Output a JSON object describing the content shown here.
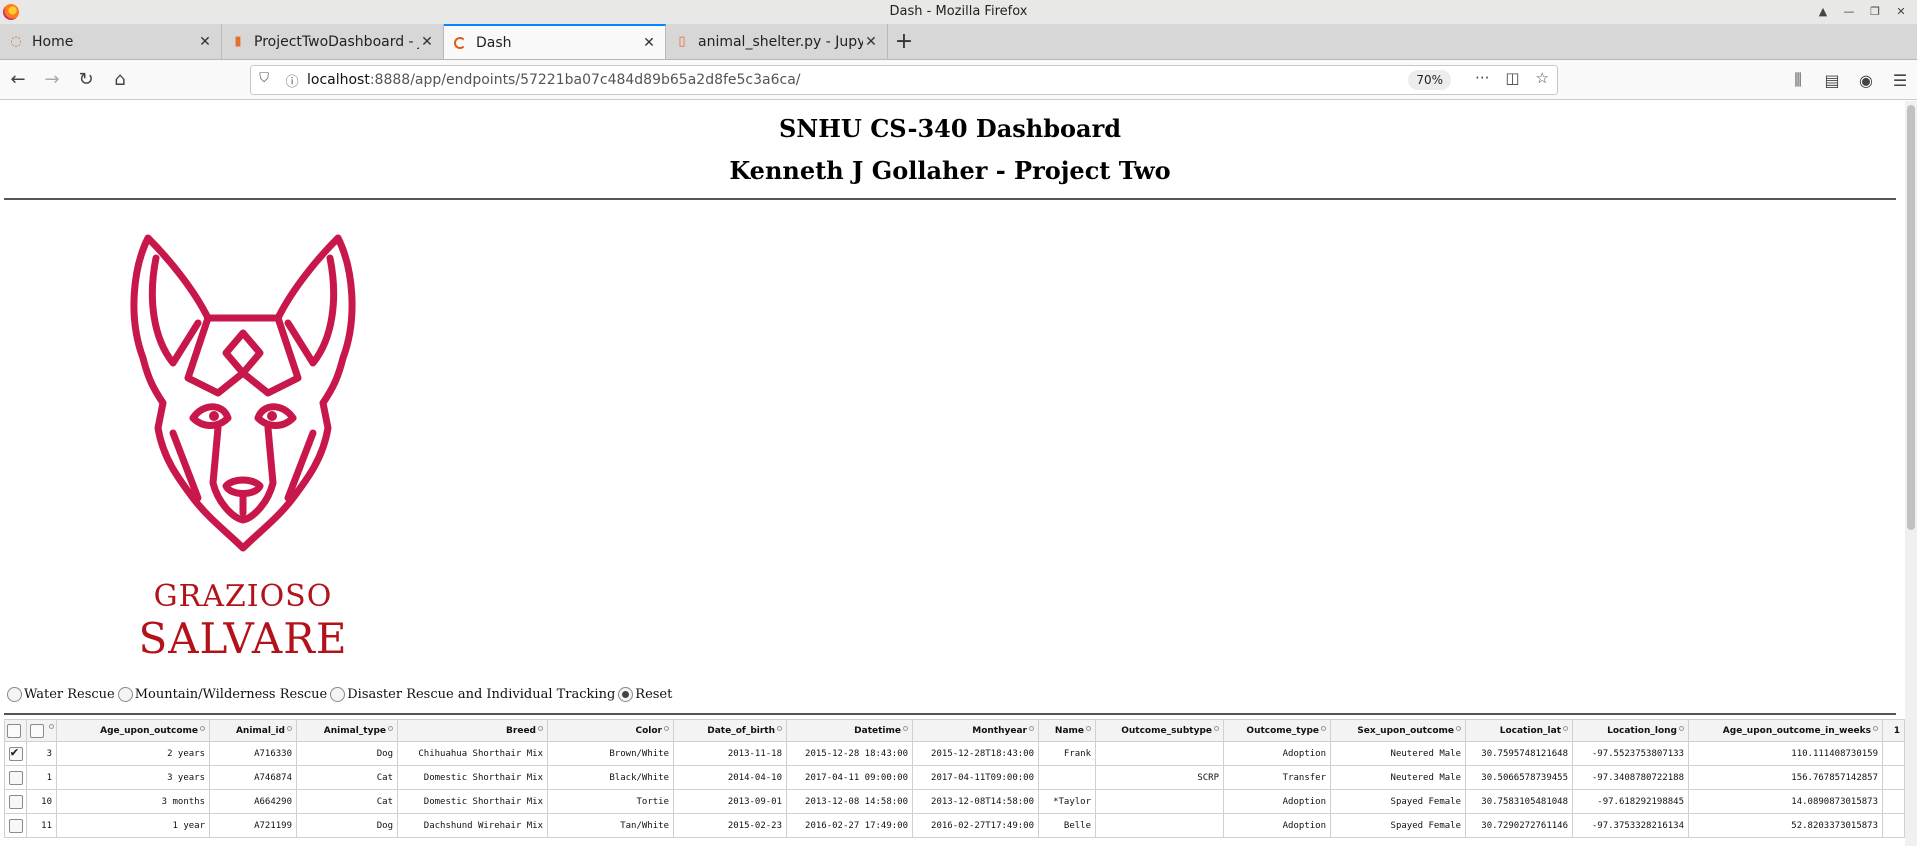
{
  "window": {
    "title": "Dash - Mozilla Firefox"
  },
  "tabs": [
    {
      "label": "Home",
      "icon": "jupyter-icon"
    },
    {
      "label": "ProjectTwoDashboard - J",
      "icon": "notebook-icon"
    },
    {
      "label": "Dash",
      "icon": "loading-spinner-icon"
    },
    {
      "label": "animal_shelter.py - Jupyt",
      "icon": "file-icon"
    }
  ],
  "url": {
    "host": "localhost",
    "path": ":8888/app/endpoints/57221ba07c484d89b65a2d8fe5c3a6ca/",
    "zoom": "70%"
  },
  "page": {
    "heading1": "SNHU CS-340 Dashboard",
    "heading2": "Kenneth J Gollaher - Project Two",
    "logo": {
      "line1": "GRAZIOSO",
      "line2": "SALVARE",
      "color": "#c8174a"
    }
  },
  "filters": {
    "options": [
      "Water Rescue",
      "Mountain/Wilderness Rescue",
      "Disaster Rescue and Individual Tracking",
      "Reset"
    ],
    "selected": "Reset"
  },
  "table": {
    "columns": [
      "",
      "Age_upon_outcome",
      "Animal_id",
      "Animal_type",
      "Breed",
      "Color",
      "Date_of_birth",
      "Datetime",
      "Monthyear",
      "Name",
      "Outcome_subtype",
      "Outcome_type",
      "Sex_upon_outcome",
      "Location_lat",
      "Location_long",
      "Age_upon_outcome_in_weeks",
      "1"
    ],
    "rows": [
      {
        "checked": true,
        "cells": [
          "3",
          "2 years",
          "A716330",
          "Dog",
          "Chihuahua Shorthair Mix",
          "Brown/White",
          "2013-11-18",
          "2015-12-28 18:43:00",
          "2015-12-28T18:43:00",
          "Frank",
          "",
          "Adoption",
          "Neutered Male",
          "30.7595748121648",
          "-97.5523753807133",
          "110.111408730159"
        ]
      },
      {
        "checked": false,
        "cells": [
          "1",
          "3 years",
          "A746874",
          "Cat",
          "Domestic Shorthair Mix",
          "Black/White",
          "2014-04-10",
          "2017-04-11 09:00:00",
          "2017-04-11T09:00:00",
          "",
          "SCRP",
          "Transfer",
          "Neutered Male",
          "30.5066578739455",
          "-97.3408780722188",
          "156.767857142857"
        ]
      },
      {
        "checked": false,
        "cells": [
          "10",
          "3 months",
          "A664290",
          "Cat",
          "Domestic Shorthair Mix",
          "Tortie",
          "2013-09-01",
          "2013-12-08 14:58:00",
          "2013-12-08T14:58:00",
          "*Taylor",
          "",
          "Adoption",
          "Spayed Female",
          "30.7583105481048",
          "-97.618292198845",
          "14.0890873015873"
        ]
      },
      {
        "checked": false,
        "cells": [
          "11",
          "1 year",
          "A721199",
          "Dog",
          "Dachshund Wirehair Mix",
          "Tan/White",
          "2015-02-23",
          "2016-02-27 17:49:00",
          "2016-02-27T17:49:00",
          "Belle",
          "",
          "Adoption",
          "Spayed Female",
          "30.7290272761146",
          "-97.3753328216134",
          "52.8203373015873"
        ]
      }
    ]
  }
}
